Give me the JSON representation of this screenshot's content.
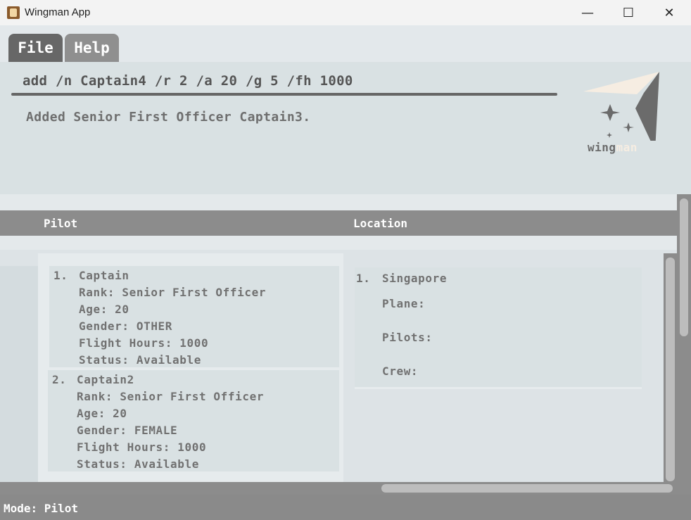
{
  "window": {
    "title": "Wingman App",
    "icons": [
      "app-icon",
      "minimize-icon",
      "maximize-icon",
      "close-icon"
    ],
    "controls": {
      "minimize": "—",
      "maximize": "☐",
      "close": "✕"
    }
  },
  "menu": {
    "file": "File",
    "help": "Help"
  },
  "command": {
    "input_value": "add /n Captain4 /r 2 /a 20 /g 5 /fh 1000",
    "result": "Added Senior First Officer Captain3."
  },
  "logo": {
    "text_dark": "wing",
    "text_light": "man"
  },
  "columns": {
    "pilot": "Pilot",
    "location": "Location"
  },
  "pilots": [
    {
      "index": "1.",
      "name": "Captain",
      "rank": "Rank: Senior First Officer",
      "age": "Age: 20",
      "gender": "Gender: OTHER",
      "flight_hours": "Flight Hours: 1000",
      "status": "Status: Available"
    },
    {
      "index": "2.",
      "name": "Captain2",
      "rank": "Rank: Senior First Officer",
      "age": "Age: 20",
      "gender": "Gender: FEMALE",
      "flight_hours": "Flight Hours: 1000",
      "status": "Status: Available"
    }
  ],
  "locations": [
    {
      "index": "1.",
      "name": "Singapore",
      "plane": "Plane:",
      "pilots": "Pilots:",
      "crew": "Crew:"
    }
  ],
  "status_bar": {
    "mode": "Mode: Pilot"
  },
  "colors": {
    "header": "#8c8c8c",
    "menu_active": "#676767",
    "background": "#dde3e6"
  }
}
